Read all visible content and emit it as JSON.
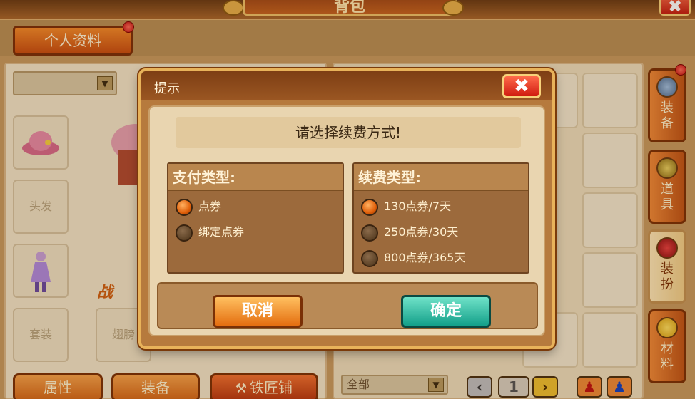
{
  "window": {
    "title": "背包",
    "close_glyph": "✖"
  },
  "profile_tab": {
    "label": "个人资料"
  },
  "left_panel": {
    "slots": {
      "hair_label": "头发",
      "suit_label": "套装",
      "wings_label": "翅膀"
    },
    "power_text": "战"
  },
  "side_tabs": [
    {
      "label": "装\n备",
      "icon": "shield-icon"
    },
    {
      "label": "道\n具",
      "icon": "chest-icon"
    },
    {
      "label": "装\n扮",
      "icon": "costume-icon"
    },
    {
      "label": "材\n料",
      "icon": "puzzle-icon"
    }
  ],
  "bottom_buttons": {
    "attributes": "属性",
    "equipment": "装备",
    "blacksmith": "铁匠铺"
  },
  "inventory_filter": {
    "selected": "全部"
  },
  "pager": {
    "page": "1",
    "prev_glyph": "‹",
    "next_glyph": "›"
  },
  "dialog": {
    "title": "提示",
    "close_glyph": "✖",
    "prompt": "请选择续费方式!",
    "payment_type": {
      "header": "支付类型:",
      "options": [
        {
          "label": "点券",
          "selected": true
        },
        {
          "label": "绑定点券",
          "selected": false
        }
      ]
    },
    "renewal_type": {
      "header": "续费类型:",
      "options": [
        {
          "label": "130点券/7天",
          "selected": true
        },
        {
          "label": "250点券/30天",
          "selected": false
        },
        {
          "label": "800点券/365天",
          "selected": false
        }
      ]
    },
    "cancel_label": "取消",
    "confirm_label": "确定"
  },
  "colors": {
    "accent_orange": "#e46e10",
    "confirm_teal": "#14a08a",
    "notification_red": "#c21010"
  }
}
